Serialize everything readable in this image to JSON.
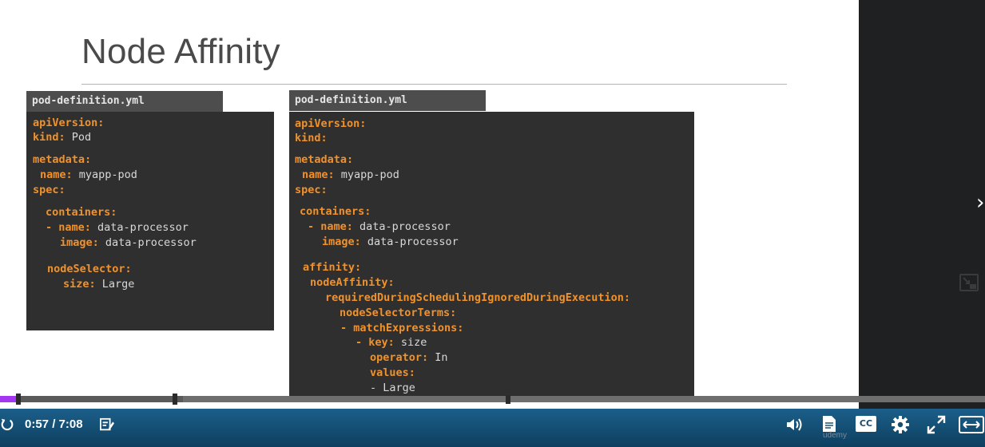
{
  "slide": {
    "title": "Node Affinity"
  },
  "left_file": {
    "tab": "pod-definition.yml",
    "lines": [
      {
        "key": "apiVersion:",
        "val": ""
      },
      {
        "key": "kind:",
        "val": " Pod"
      },
      {
        "key": "metadata:",
        "val": ""
      },
      {
        "key": "name:",
        "val": " myapp-pod"
      },
      {
        "key": "spec:",
        "val": ""
      },
      {
        "key": "containers:",
        "val": ""
      },
      {
        "key": "- name:",
        "val": " data-processor"
      },
      {
        "key": "image:",
        "val": " data-processor"
      },
      {
        "key": "nodeSelector:",
        "val": ""
      },
      {
        "key": "size:",
        "val": " Large"
      }
    ]
  },
  "right_file": {
    "tab": "pod-definition.yml",
    "lines": [
      {
        "key": "apiVersion:",
        "val": ""
      },
      {
        "key": "kind:",
        "val": ""
      },
      {
        "key": "metadata:",
        "val": ""
      },
      {
        "key": "name:",
        "val": " myapp-pod"
      },
      {
        "key": "spec:",
        "val": ""
      },
      {
        "key": "containers:",
        "val": ""
      },
      {
        "key": "- name:",
        "val": " data-processor"
      },
      {
        "key": "image:",
        "val": " data-processor"
      },
      {
        "key": "affinity:",
        "val": ""
      },
      {
        "key": "nodeAffinity:",
        "val": ""
      },
      {
        "key": "requiredDuringSchedulingIgnoredDuringExecution:",
        "val": ""
      },
      {
        "key": "nodeSelectorTerms:",
        "val": ""
      },
      {
        "key": "- matchExpressions:",
        "val": ""
      },
      {
        "key": "- key:",
        "val": " size"
      },
      {
        "key": "operator:",
        "val": " In"
      },
      {
        "key": "values:",
        "val": ""
      },
      {
        "key": "",
        "val": "- Large"
      }
    ]
  },
  "player": {
    "time": "0:57 / 7:08",
    "progress_fraction": 0.018,
    "cc_label": "CC",
    "watermark": "udemy",
    "icons": [
      "replay-icon",
      "notes-icon",
      "volume-icon",
      "transcript-icon",
      "captions-icon",
      "settings-icon",
      "fullscreen-icon",
      "expand-icon"
    ],
    "accent_color": "#a435f0"
  },
  "sidebar": {
    "icons": [
      "close-sidebar-icon",
      "picture-in-picture-icon"
    ]
  }
}
